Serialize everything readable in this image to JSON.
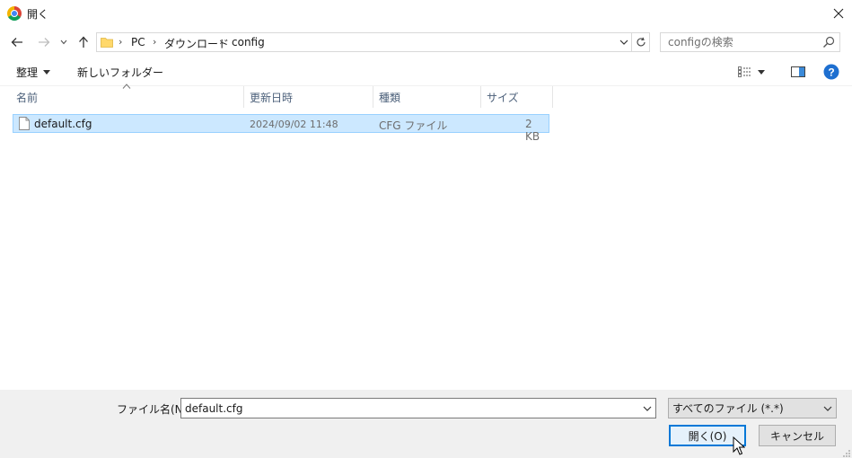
{
  "window": {
    "title": "開く",
    "close_icon": "close-icon",
    "app_icon": "chrome-icon"
  },
  "nav": {
    "back_icon": "back-arrow-icon",
    "forward_icon": "forward-arrow-icon",
    "recent_icon": "chevron-down-icon",
    "up_icon": "up-arrow-icon",
    "breadcrumb": [
      "PC",
      "ダウンロード",
      "config"
    ],
    "separator": "›",
    "search_placeholder": "configの検索"
  },
  "toolbar": {
    "organize_label": "整理",
    "new_folder_label": "新しいフォルダー",
    "help_label": "?"
  },
  "columns": {
    "name": "名前",
    "modified": "更新日時",
    "type": "種類",
    "size": "サイズ"
  },
  "files": [
    {
      "name": "default.cfg",
      "modified": "2024/09/02 11:48",
      "type": "CFG ファイル",
      "size": "2 KB",
      "selected": true
    }
  ],
  "footer": {
    "filename_label": "ファイル名(N):",
    "filename_value": "default.cfg",
    "filetype_value": "すべてのファイル (*.*)",
    "open_label": "開く(O)",
    "cancel_label": "キャンセル"
  },
  "colors": {
    "selection_bg": "#cce8ff",
    "selection_border": "#99d1ff",
    "accent": "#0078d7",
    "folder": "#ffd86b",
    "help": "#1e6fd0"
  }
}
